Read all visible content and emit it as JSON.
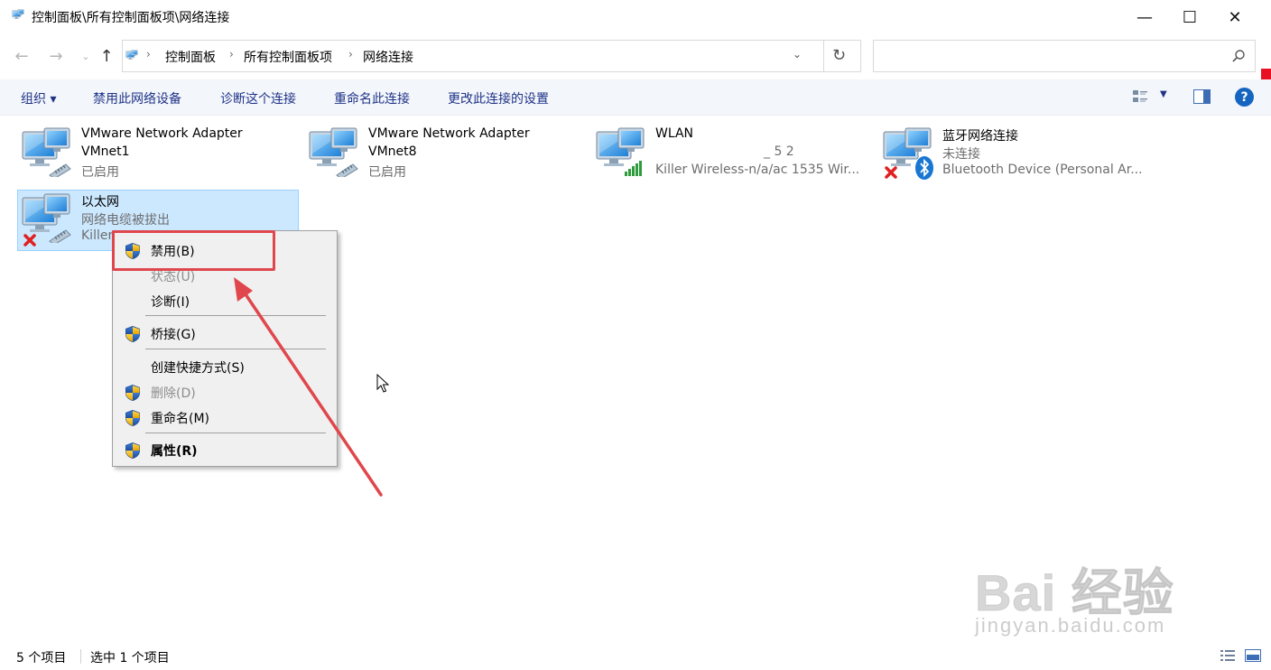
{
  "window": {
    "title": "控制面板\\所有控制面板项\\网络连接",
    "min_glyph": "—",
    "max_glyph": "☐",
    "close_glyph": "✕"
  },
  "nav": {
    "back_glyph": "←",
    "forward_glyph": "→",
    "recent_glyph": "⌄",
    "up_glyph": "↑",
    "breadcrumbs": [
      "控制面板",
      "所有控制面板项",
      "网络连接"
    ],
    "crumb_sep": "›",
    "dropdown_glyph": "⌄",
    "refresh_glyph": "↻",
    "search_placeholder": ""
  },
  "toolbar": {
    "organize": "组织 ▾",
    "disable_device": "禁用此网络设备",
    "diagnose": "诊断这个连接",
    "rename": "重命名此连接",
    "change_settings": "更改此连接的设置",
    "view_dropdown": "▼",
    "help": "?"
  },
  "connections": [
    {
      "name": "VMware Network Adapter",
      "name2": "VMnet1",
      "status": "已启用",
      "device": ""
    },
    {
      "name": "VMware Network Adapter",
      "name2": "VMnet8",
      "status": "已启用",
      "device": ""
    },
    {
      "name": "WLAN",
      "name2": "",
      "status": "_ 5 2",
      "device": "Killer Wireless-n/a/ac 1535 Wir..."
    },
    {
      "name": "蓝牙网络连接",
      "name2": "",
      "status": "未连接",
      "device": "Bluetooth Device (Personal Ar..."
    },
    {
      "name": "以太网",
      "name2": "",
      "status": "网络电缆被拔出",
      "device": "Killer"
    }
  ],
  "context_menu": {
    "disable": "禁用(B)",
    "status": "状态(U)",
    "diagnose": "诊断(I)",
    "bridge": "桥接(G)",
    "shortcut": "创建快捷方式(S)",
    "delete": "删除(D)",
    "rename": "重命名(M)",
    "properties": "属性(R)"
  },
  "statusbar": {
    "count": "5 个项目",
    "selected": "选中 1 个项目"
  },
  "watermark": {
    "brand": "Bai 经验",
    "url": "jingyan.baidu.com"
  },
  "colors": {
    "accent": "#1e3287",
    "selection": "#cce8ff",
    "annotation_red": "#e0474c",
    "close_red": "#e81123"
  }
}
